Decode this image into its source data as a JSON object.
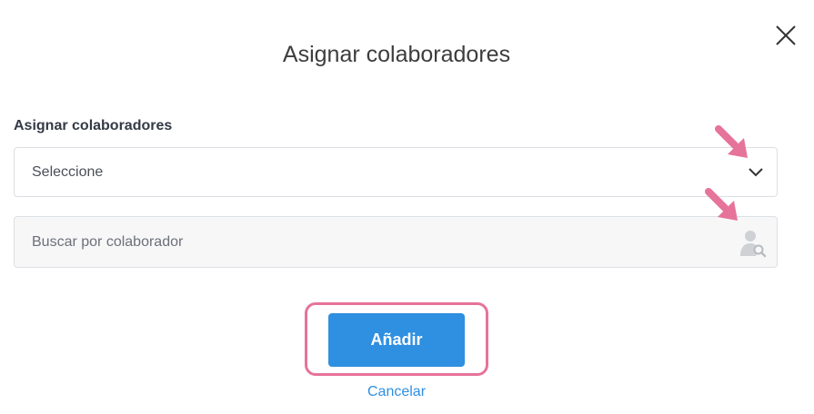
{
  "dialog": {
    "title": "Asignar colaboradores",
    "close_icon": "close-icon"
  },
  "form": {
    "label": "Asignar colaboradores",
    "select": {
      "value": "Seleccione",
      "icon": "chevron-down-icon"
    },
    "search": {
      "placeholder": "Buscar por colaborador",
      "value": "",
      "icon": "person-search-icon"
    }
  },
  "actions": {
    "add_label": "Añadir",
    "cancel_label": "Cancelar"
  },
  "annotations": {
    "arrow_icon": "pointer-arrow-icon",
    "highlight_color": "#e6739a"
  },
  "colors": {
    "primary": "#2f8fe0",
    "title_text": "#3d3d3d",
    "label_text": "#333a45"
  }
}
